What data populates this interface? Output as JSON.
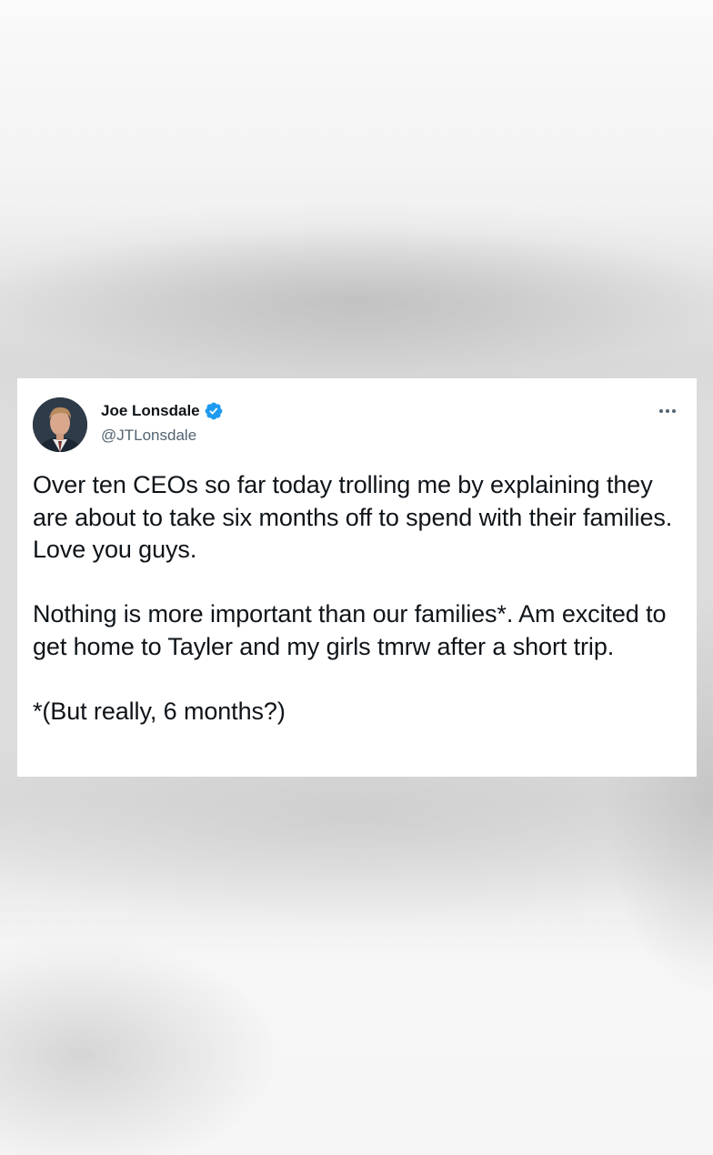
{
  "tweet": {
    "author": {
      "name": "Joe Lonsdale",
      "handle": "@JTLonsdale",
      "verified": true,
      "avatar_icon": "profile-photo"
    },
    "more_icon": "more-horizontal-icon",
    "paragraphs": [
      "Over ten CEOs so far today trolling me by explaining they are about to take six months off to spend with their families.  Love you guys.",
      "Nothing is more important than our families*. Am excited to get home to Tayler and my girls tmrw after a short trip.",
      "*(But really, 6 months?)"
    ]
  },
  "colors": {
    "verified_blue": "#1d9bf0",
    "text_primary": "#0f1419",
    "text_secondary": "#536471",
    "card_background": "#ffffff"
  }
}
